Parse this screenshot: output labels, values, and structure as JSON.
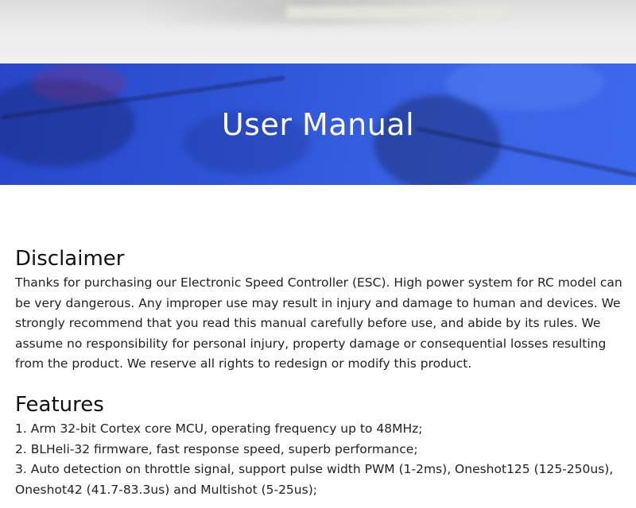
{
  "hero": {
    "title": "User Manual"
  },
  "disclaimer": {
    "heading": "Disclaimer",
    "body": "Thanks for purchasing our Electronic Speed Controller (ESC). High power system for RC model can be very dangerous. Any improper use may result in injury and damage to human and devices. We strongly recommend that you read this manual carefully before use, and abide by its rules. We assume no responsibility for personal injury, property damage or consequential losses resulting from the product. We reserve all rights to redesign or modify this product."
  },
  "features": {
    "heading": "Features",
    "items": [
      "1. Arm 32-bit Cortex core MCU, operating frequency up to 48MHz;",
      "2. BLHeli-32 firmware, fast response speed, superb performance;",
      "3. Auto detection on throttle signal, support pulse width PWM (1-2ms), Oneshot125 (125-250us), Oneshot42 (41.7-83.3us) and Multishot (5-25us);"
    ]
  },
  "colors": {
    "banner_blue": "#2f55d8",
    "text": "#222222",
    "background": "#ffffff"
  }
}
